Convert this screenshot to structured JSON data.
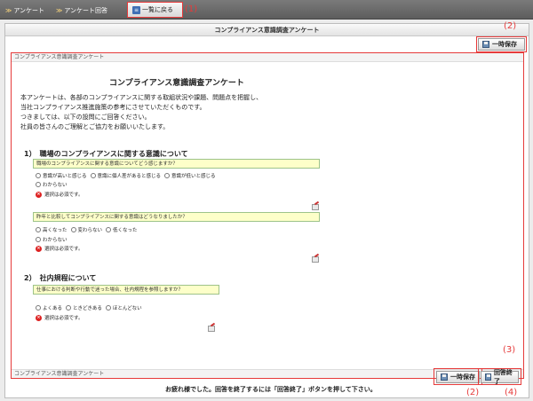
{
  "nav": {
    "crumb1": "アンケート",
    "crumb2": "アンケート回答",
    "back_label": "一覧に戻る"
  },
  "annotations": {
    "a1": "(1)",
    "a2_top": "(2)",
    "a3": "(3)",
    "a2_bottom": "(2)",
    "a4": "(4)"
  },
  "panel": {
    "title": "コンプライアンス意識調査アンケート",
    "save_label": "一時保存",
    "finish_label": "回答終了",
    "bottom_message": "お疲れ様でした。回答を終了するには「回答終了」ボタンを押して下さい。"
  },
  "survey": {
    "header": "コンプライアンス意識調査アンケート",
    "footer": "コンプライアンス意識調査アンケート",
    "title": "コンプライアンス意識調査アンケート",
    "intro": [
      "本アンケートは、各部のコンプライアンスに関する取組状況や課題、問題点を把握し、",
      "当社コンプライアンス推進施策の参考にさせていただくものです。",
      "つきましては、以下の設問にご回答ください。",
      "社員の皆さんのご理解とご協力をお願いいたします。"
    ],
    "section1": "1）　職場のコンプライアンスに関する意識について",
    "q1": "職場のコンプライアンスに関する意識についてどう感じますか？",
    "q1_opts": [
      "意識が高いと感じる",
      "意識に個人差があると感じる",
      "意識が低いと感じる"
    ],
    "q1_opt4": "わからない",
    "required": "選択は必須です。",
    "q2": "昨年と比較してコンプライアンスに関する意識はどうなりましたか？",
    "q2_opts": [
      "高くなった",
      "変わらない",
      "低くなった"
    ],
    "q2_opt4": "わからない",
    "section2": "2）　社内規程について",
    "q3": "仕事における判断や行動で迷った場合、社内規程を参照しますか？",
    "q3_opts": [
      "よくある",
      "ときどきある",
      "ほとんどない"
    ]
  },
  "colors": {
    "annotation": "#e63a3a",
    "question_bg": "#fdffc9"
  }
}
